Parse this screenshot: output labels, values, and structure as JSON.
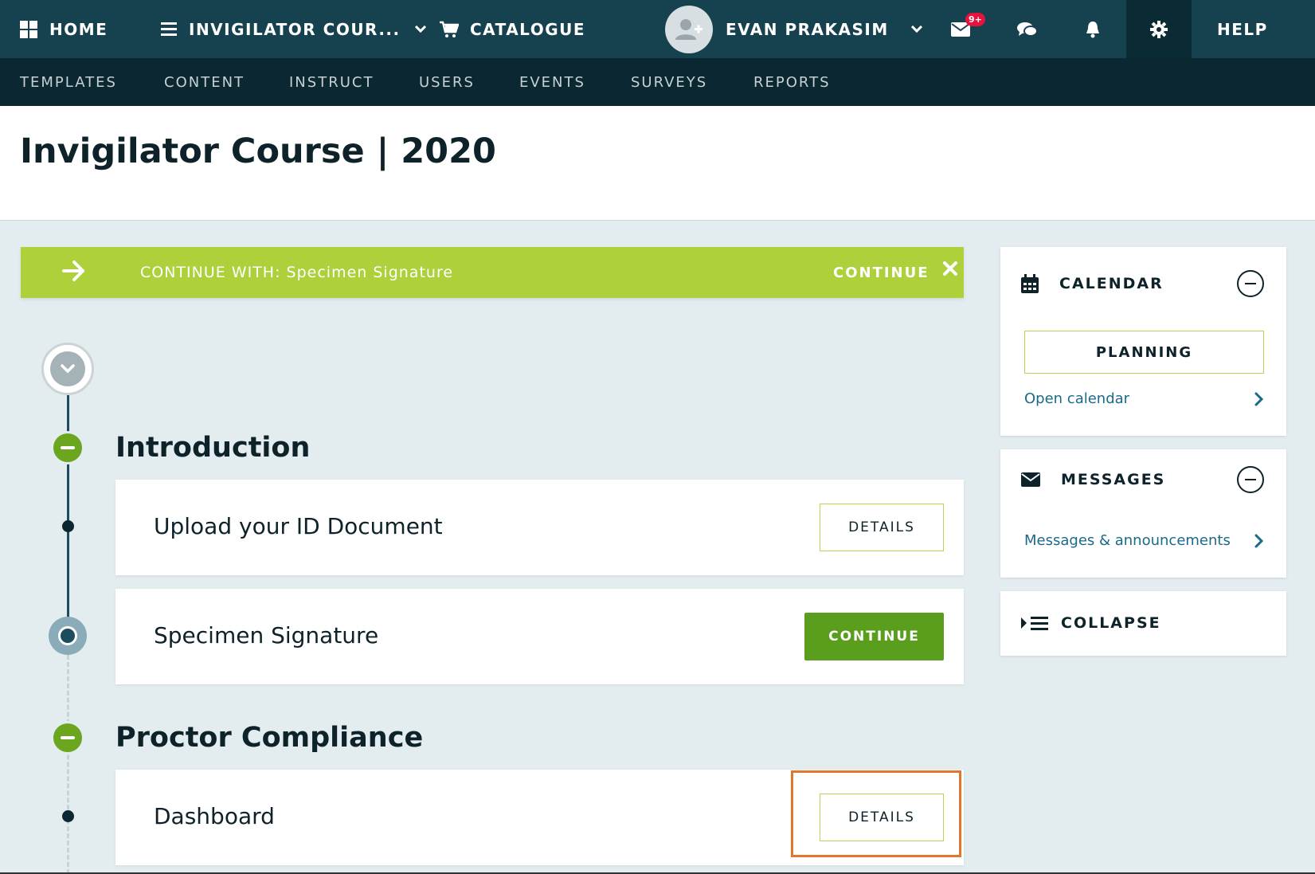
{
  "topbar": {
    "home_label": "HOME",
    "course_label": "INVIGILATOR COUR...",
    "catalogue_label": "CATALOGUE",
    "user_name": "EVAN PRAKASIM",
    "messages_badge": "9+",
    "help_label": "HELP"
  },
  "subnav": {
    "items": [
      "TEMPLATES",
      "CONTENT",
      "INSTRUCT",
      "USERS",
      "EVENTS",
      "SURVEYS",
      "REPORTS"
    ]
  },
  "page": {
    "title": "Invigilator Course | 2020"
  },
  "banner": {
    "prefix": "CONTINUE WITH:",
    "item": "Specimen Signature",
    "continue_label": "CONTINUE"
  },
  "sections": [
    {
      "title": "Introduction",
      "items": [
        {
          "title": "Upload your ID Document",
          "button": "DETAILS"
        },
        {
          "title": "Specimen Signature",
          "button": "CONTINUE"
        }
      ]
    },
    {
      "title": "Proctor Compliance",
      "items": [
        {
          "title": "Dashboard",
          "button": "DETAILS"
        }
      ]
    }
  ],
  "sidebar": {
    "calendar": {
      "title": "CALENDAR",
      "planning_label": "PLANNING",
      "link_label": "Open calendar"
    },
    "messages": {
      "title": "MESSAGES",
      "link_label": "Messages & announcements"
    },
    "collapse": {
      "label": "COLLAPSE"
    }
  },
  "colors": {
    "topbar": "#16414f",
    "subnav": "#0b2731",
    "accent_green": "#5a9e1e",
    "banner_green": "#aed13b",
    "highlight": "#e0772c"
  }
}
